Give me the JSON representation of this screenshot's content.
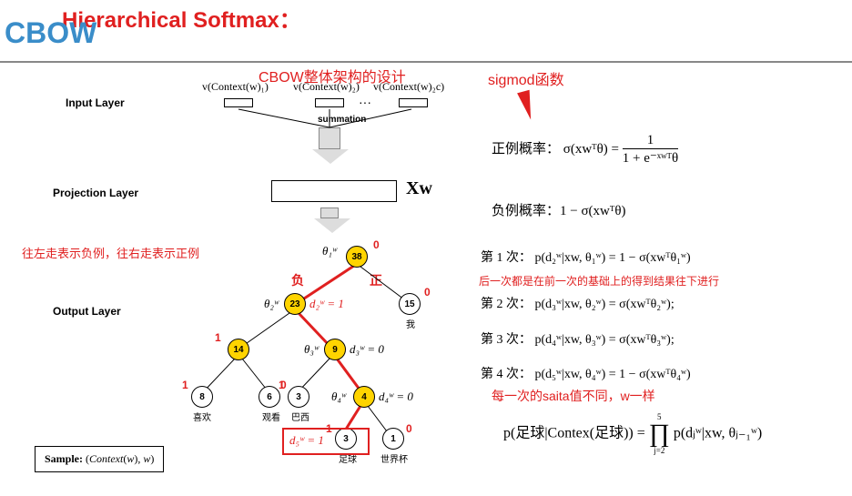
{
  "title": "Hierarchical Softmax：",
  "cbow": "CBOW",
  "subtitle": "CBOW整体架构的设计",
  "sigmod": "sigmod函数",
  "layers": {
    "input": "Input Layer",
    "projection": "Projection Layer",
    "output": "Output Layer"
  },
  "context_labels": [
    "v(Context(w)₁)",
    "v(Context(w)₂)",
    "v(Context(w)₂c)"
  ],
  "summation": "summation",
  "xw": "Xw",
  "note_left": "往左走表示负例，往右走表示正例",
  "neg": "负",
  "pos": "正",
  "tree": {
    "n38": "38",
    "n23": "23",
    "n15": "15",
    "n14": "14",
    "n9": "9",
    "n8": "8",
    "n6": "6",
    "n3a": "3",
    "n4": "4",
    "n3b": "3",
    "n1": "1",
    "labels": {
      "n15": "我",
      "n8": "喜欢",
      "n6": "观看",
      "n3a": "巴西",
      "n3b": "足球",
      "n1": "世界杯"
    },
    "theta": {
      "t1": "θ₁ʷ",
      "t2": "θ₂ʷ",
      "t3": "θ₃ʷ",
      "t4": "θ₄ʷ"
    },
    "d": {
      "d2": "d₂ʷ = 1",
      "d3": "d₃ʷ = 0",
      "d4": "d₄ʷ = 0",
      "d5": "d₅ʷ = 1"
    }
  },
  "ones": [
    "1",
    "0",
    "1",
    "0",
    "1",
    "0",
    "1",
    "0",
    "1",
    "0"
  ],
  "sample": "Sample:  (Context(w), w)",
  "pos_prob_label": "正例概率：",
  "pos_prob_eq": "σ(xwᵀθ) = ",
  "frac_top": "1",
  "frac_bot": "1 + e⁻ˣʷᵀθ",
  "neg_prob_label": "负例概率：",
  "neg_prob_eq": "1 − σ(xwᵀθ)",
  "steps": {
    "s1": "第 1 次：  p(d₂ʷ|xw, θ₁ʷ) = 1 − σ(xwᵀθ₁ʷ)",
    "note_mid": "后一次都是在前一次的基础上的得到结果往下进行",
    "s2": "第 2 次：  p(d₃ʷ|xw, θ₂ʷ) = σ(xwᵀθ₂ʷ);",
    "s3": "第 3 次：  p(d₄ʷ|xw, θ₃ʷ) = σ(xwᵀθ₃ʷ);",
    "s4": "第 4 次：  p(d₅ʷ|xw, θ₄ʷ) = 1 − σ(xwᵀθ₄ʷ)",
    "note_bot": "每一次的saita值不同，w一样",
    "final_l": "p(足球|Contex(足球)) = ",
    "final_r": "∏ p(dⱼʷ|xw, θⱼ₋₁ʷ)",
    "prod_top": "5",
    "prod_bot": "j=2"
  }
}
